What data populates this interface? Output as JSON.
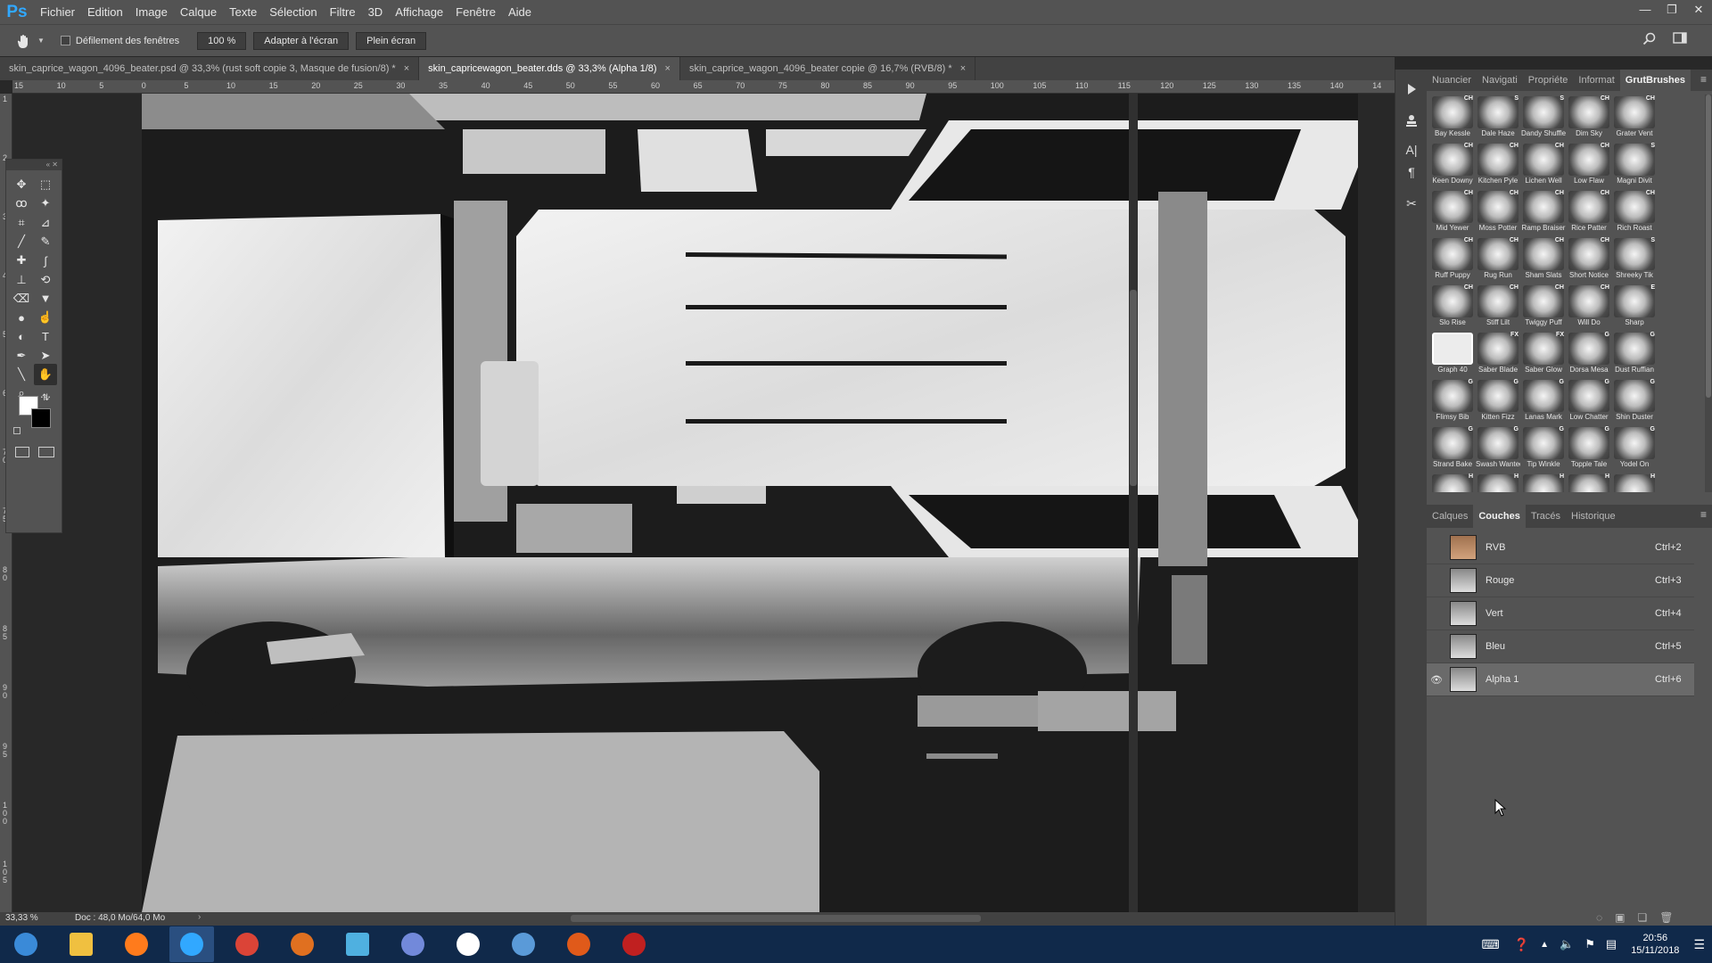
{
  "app": {
    "logo": "Ps"
  },
  "menu": [
    "Fichier",
    "Edition",
    "Image",
    "Calque",
    "Texte",
    "Sélection",
    "Filtre",
    "3D",
    "Affichage",
    "Fenêtre",
    "Aide"
  ],
  "options": {
    "scroll_all_label": "Défilement des fenêtres",
    "zoom_btn": "100 %",
    "fit_btn": "Adapter à l'écran",
    "fill_btn": "Plein écran"
  },
  "tabs": [
    {
      "label": "skin_caprice_wagon_4096_beater.psd @ 33,3% (rust soft copie 3, Masque de fusion/8) *",
      "active": false
    },
    {
      "label": "skin_capricewagon_beater.dds @ 33,3% (Alpha 1/8)",
      "active": true
    },
    {
      "label": "skin_caprice_wagon_4096_beater copie @ 16,7% (RVB/8) *",
      "active": false
    }
  ],
  "ruler_top": [
    "15",
    "10",
    "5",
    "0",
    "5",
    "10",
    "15",
    "20",
    "25",
    "30",
    "35",
    "40",
    "45",
    "50",
    "55",
    "60",
    "65",
    "70",
    "75",
    "80",
    "85",
    "90",
    "95",
    "100",
    "105",
    "110",
    "115",
    "120",
    "125",
    "130",
    "135",
    "140",
    "14"
  ],
  "ruler_left": [
    "1",
    "2",
    "3",
    "4",
    "5",
    "6",
    "7 0",
    "7 5",
    "8 0",
    "8 5",
    "9 0",
    "9 5",
    "1 0 0",
    "1 0 5"
  ],
  "brush_panel": {
    "tabs": [
      "Nuancier",
      "Navigati",
      "Propriéte",
      "Informat",
      "GrutBrushes"
    ],
    "active_tab": 4,
    "brushes": [
      {
        "name": "Bay Kessle",
        "tag": "CH"
      },
      {
        "name": "Dale Haze",
        "tag": "S"
      },
      {
        "name": "Dandy Shuffle",
        "tag": "S"
      },
      {
        "name": "Dim Sky",
        "tag": "CH"
      },
      {
        "name": "Grater Vent",
        "tag": "CH"
      },
      {
        "name": "Keen Downy",
        "tag": "CH"
      },
      {
        "name": "Kitchen Pyle",
        "tag": "CH"
      },
      {
        "name": "Lichen Well",
        "tag": "CH"
      },
      {
        "name": "Low Flaw",
        "tag": "CH"
      },
      {
        "name": "Magni Divit",
        "tag": "S"
      },
      {
        "name": "Mid Yewer",
        "tag": "CH"
      },
      {
        "name": "Moss Potter",
        "tag": "CH"
      },
      {
        "name": "Ramp Braiser",
        "tag": "CH"
      },
      {
        "name": "Rice Patter",
        "tag": "CH"
      },
      {
        "name": "Rich Roast",
        "tag": "CH"
      },
      {
        "name": "Ruff Puppy",
        "tag": "CH"
      },
      {
        "name": "Rug Run",
        "tag": "CH"
      },
      {
        "name": "Sham Slats",
        "tag": "CH"
      },
      {
        "name": "Short Notice",
        "tag": "CH"
      },
      {
        "name": "Shreeky Tik",
        "tag": "S"
      },
      {
        "name": "Slo Rise",
        "tag": "CH"
      },
      {
        "name": "Stiff Lilt",
        "tag": "CH"
      },
      {
        "name": "Twiggy Puff",
        "tag": "CH"
      },
      {
        "name": "Will Do",
        "tag": "CH"
      },
      {
        "name": "Sharp",
        "tag": "E"
      },
      {
        "name": "Graph 40",
        "tag": ""
      },
      {
        "name": "Saber Blade",
        "tag": "FX"
      },
      {
        "name": "Saber Glow",
        "tag": "FX"
      },
      {
        "name": "Dorsa Mesa",
        "tag": "G"
      },
      {
        "name": "Dust Ruffian",
        "tag": "G"
      },
      {
        "name": "Flimsy Bib",
        "tag": "G"
      },
      {
        "name": "Kitten Fizz",
        "tag": "G"
      },
      {
        "name": "Lanas Mark",
        "tag": "G"
      },
      {
        "name": "Low Chatter",
        "tag": "G"
      },
      {
        "name": "Shin Duster",
        "tag": "G"
      },
      {
        "name": "Strand Bake",
        "tag": "G"
      },
      {
        "name": "Swash Wanted",
        "tag": "G"
      },
      {
        "name": "Tip Winkle",
        "tag": "G"
      },
      {
        "name": "Topple Tale",
        "tag": "G"
      },
      {
        "name": "Yodel On",
        "tag": "G"
      },
      {
        "name": "",
        "tag": "H"
      },
      {
        "name": "",
        "tag": "H"
      },
      {
        "name": "",
        "tag": "H"
      },
      {
        "name": "",
        "tag": "H"
      },
      {
        "name": "",
        "tag": "H"
      }
    ]
  },
  "channels_panel": {
    "tabs": [
      "Calques",
      "Couches",
      "Tracés",
      "Historique"
    ],
    "active_tab": 1,
    "channels": [
      {
        "name": "RVB",
        "shortcut": "Ctrl+2",
        "visible": false,
        "selected": false
      },
      {
        "name": "Rouge",
        "shortcut": "Ctrl+3",
        "visible": false,
        "selected": false
      },
      {
        "name": "Vert",
        "shortcut": "Ctrl+4",
        "visible": false,
        "selected": false
      },
      {
        "name": "Bleu",
        "shortcut": "Ctrl+5",
        "visible": false,
        "selected": false
      },
      {
        "name": "Alpha 1",
        "shortcut": "Ctrl+6",
        "visible": true,
        "selected": true
      }
    ]
  },
  "status": {
    "zoom": "33,33 %",
    "doc": "Doc : 48,0 Mo/64,0 Mo"
  },
  "taskbar": {
    "apps": [
      "start-orb",
      "file-explorer",
      "firefox",
      "photoshop",
      "chrome",
      "eye-app",
      "notepad",
      "discord",
      "w-app",
      "shield-app",
      "share-app",
      "red-app"
    ],
    "active": "photoshop",
    "time": "20:56",
    "date": "15/11/2018"
  },
  "colors": {
    "accent": "#31a8ff",
    "panel": "#535353",
    "dark": "#424242"
  }
}
